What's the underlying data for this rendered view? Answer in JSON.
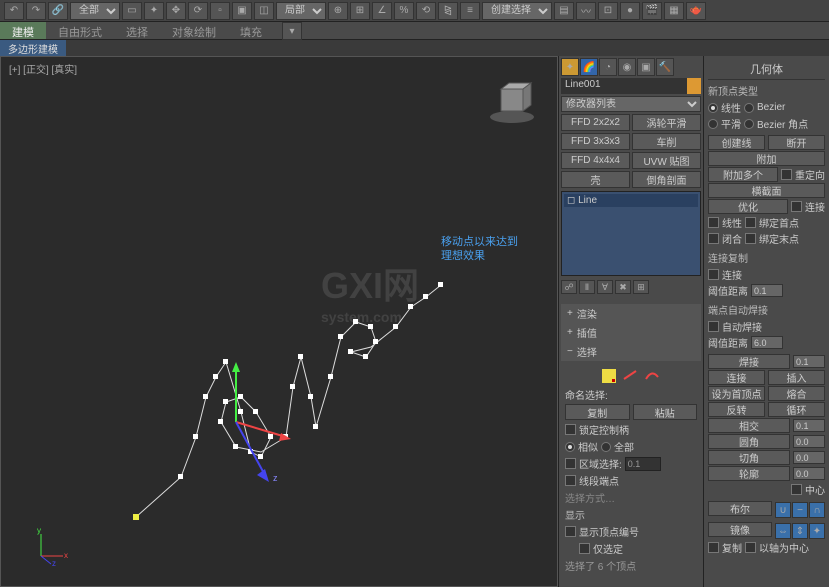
{
  "toolbar": {
    "dropdown1": "全部",
    "dropdown2": "局部",
    "dropdown3": "创建选择集"
  },
  "tabs": [
    "建模",
    "自由形式",
    "选择",
    "对象绘制",
    "填充"
  ],
  "subtab": "多边形建模",
  "viewport": {
    "label": "[+] [正交] [真实]",
    "hint_line1": "移动点以来达到",
    "hint_line2": "理想效果",
    "watermark_top": "GXI网",
    "watermark_sub": "system.com"
  },
  "midpanel": {
    "object_name": "Line001",
    "modifier_dropdown": "修改器列表",
    "buttons": [
      "FFD 2x2x2",
      "涡轮平滑",
      "FFD 3x3x3",
      "车削",
      "FFD 4x4x4",
      "UVW 贴图",
      "壳",
      "倒角剖面"
    ],
    "list_item": "Line",
    "rollouts": {
      "render": "渲染",
      "interp": "插值",
      "select": "选择"
    },
    "named_sel": "命名选择:",
    "copy": "复制",
    "paste": "粘贴",
    "lock_handles": "锁定控制柄",
    "similar": "相似",
    "all": "全部",
    "area_select": "区域选择:",
    "area_val": "0.1",
    "segment_end": "线段端点",
    "select_method": "选择方式…",
    "display": "显示",
    "show_vertex_num": "显示顶点编号",
    "only_selected": "仅选定",
    "status": "选择了 6 个顶点"
  },
  "rightpanel": {
    "title": "几何体",
    "vertex_type": "新顶点类型",
    "linear": "线性",
    "bezier": "Bezier",
    "smooth": "平滑",
    "bezier_corner": "Bezier 角点",
    "create_line": "创建线",
    "break": "断开",
    "attach": "附加",
    "reorient": "重定向",
    "attach_mult": "附加多个",
    "cross_section": "横截面",
    "optimize": "优化",
    "connect": "连接",
    "linear2": "线性",
    "bind_first": "绑定首点",
    "closed": "闭合",
    "bind_last": "绑定末点",
    "connect_copy": "连接复制",
    "connect2": "连接",
    "threshold": "阈值距离",
    "threshold_val": "0.1",
    "endpoint_auto_weld": "端点自动焊接",
    "auto_weld": "自动焊接",
    "threshold2": "阈值距离",
    "threshold2_val": "6.0",
    "weld": "焊接",
    "weld_val": "0.1",
    "connect3": "连接",
    "insert": "插入",
    "make_first": "设为首顶点",
    "fuse": "熔合",
    "reverse": "反转",
    "cycle": "循环",
    "intersect": "相交",
    "intersect_val": "0.1",
    "fillet": "圆角",
    "fillet_val": "0.0",
    "chamfer": "切角",
    "chamfer_val": "0.0",
    "outline": "轮廓",
    "outline_val": "0.0",
    "center": "中心",
    "boolean": "布尔",
    "mirror": "镜像",
    "copy2": "复制",
    "axis_center": "以轴为中心"
  }
}
